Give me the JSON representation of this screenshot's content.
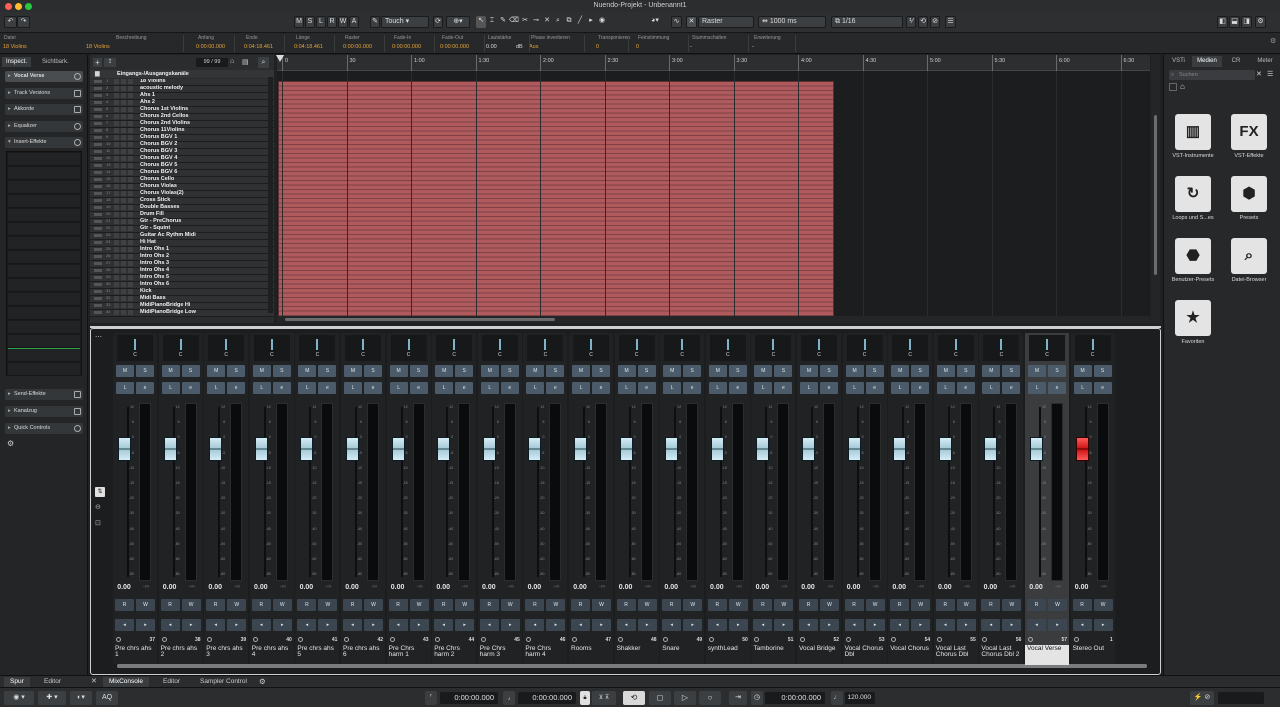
{
  "window": {
    "title": "Nuendo-Projekt - Unbenannt1"
  },
  "toolbar": {
    "mode_buttons": [
      "M",
      "S",
      "L",
      "R",
      "W",
      "A"
    ],
    "automation_mode": "Touch",
    "grid_label": "Raster",
    "nudge_value": "1000 ms",
    "quantize_value": "1/16"
  },
  "infoline": {
    "fields": [
      {
        "label": "Datei",
        "value": "18 Violins"
      },
      {
        "label": "Beschreibung",
        "value": "18 Violins"
      },
      {
        "label": "Anfang",
        "value": "0:00:00.000"
      },
      {
        "label": "Ende",
        "value": "0:04:18.461"
      },
      {
        "label": "Länge",
        "value": "0:04:18.461"
      },
      {
        "label": "Raster",
        "value": "0:00:00.000"
      },
      {
        "label": "Fade-In",
        "value": "0:00:00.000"
      },
      {
        "label": "Fade-Out",
        "value": "0:00:00.000"
      },
      {
        "label": "Lautstärke",
        "value": "0.00"
      },
      {
        "label": "Phase invertieren",
        "value": "Aus"
      },
      {
        "label": "Transponieren",
        "value": "0"
      },
      {
        "label": "Feinstimmung",
        "value": "0"
      },
      {
        "label": "Stummschalten",
        "value": "-"
      },
      {
        "label": "Erweiterung",
        "value": "-"
      }
    ],
    "volume_unit": "dB"
  },
  "inspector": {
    "tabs": [
      "Inspect.",
      "Sichtbark."
    ],
    "track_name": "Vocal Verse",
    "sections": [
      "Track Versions",
      "Akkorde",
      "Equalizer",
      "Insert-Effekte"
    ],
    "bottom_sections": [
      "Send-Effekte",
      "Kanalzug",
      "Quick Controls"
    ]
  },
  "tracklist": {
    "counter": "99 / 99",
    "header": "Eingangs-/Ausgangskanäle",
    "tracks": [
      "18 Violins",
      "acoustic melody",
      "Ahs 1",
      "Ahs 2",
      "Chorus 1st Violins",
      "Chorus 2nd Cellos",
      "Chorus 2nd Violins",
      "Chorus 11Violins",
      "Chorus BGV 1",
      "Chorus BGV 2",
      "Chorus BGV 3",
      "Chorus BGV 4",
      "Chorus BGV 5",
      "Chorus BGV 6",
      "Chorus Cello",
      "Chorus Violas",
      "Chorus Violas(2)",
      "Cross Stick",
      "Double Basses",
      "Drum Fill",
      "Gtr - PreChorus",
      "Gtr - Squint",
      "Guitar Ac Rythm Midi",
      "Hi Hat",
      "Intro Ohs 1",
      "Intro Ohs 2",
      "Intro Ohs 3",
      "Intro Ohs 4",
      "Intro Ohs 5",
      "Intro Ohs 6",
      "Kick",
      "Midi Bass",
      "MidiPianoBridge Hi",
      "MidiPianoBridge Low"
    ]
  },
  "ruler": {
    "ticks": [
      "0",
      "30",
      "1:00",
      "1:30",
      "2:00",
      "2:30",
      "3:00",
      "3:30",
      "4:00",
      "4:30",
      "5:00",
      "5:30",
      "6:00",
      "6:30"
    ]
  },
  "right_zone": {
    "tabs": [
      "VSTi",
      "Medien",
      "CR",
      "Meter"
    ],
    "active_tab": "Medien",
    "search_placeholder": "Suchen",
    "items": [
      {
        "label": "VST-Instrumente",
        "icon": "piano-keys-icon",
        "glyph": "▥"
      },
      {
        "label": "VST-Effekte",
        "icon": "fx-icon",
        "glyph": "FX"
      },
      {
        "label": "Loops und S...es",
        "icon": "loop-icon",
        "glyph": "↻"
      },
      {
        "label": "Presets",
        "icon": "presets-icon",
        "glyph": "⬢"
      },
      {
        "label": "Benutzer-Presets",
        "icon": "user-presets-icon",
        "glyph": "⬣"
      },
      {
        "label": "Datei-Browser",
        "icon": "file-browser-icon",
        "glyph": "⌕"
      },
      {
        "label": "Favoriten",
        "icon": "star-icon",
        "glyph": "★"
      }
    ]
  },
  "mixer": {
    "channels": [
      {
        "name": "Pre chrs ahs 1",
        "num": "37",
        "vol": "0.00",
        "pan": "C"
      },
      {
        "name": "Pre chrs ahs 2",
        "num": "38",
        "vol": "0.00",
        "pan": "C"
      },
      {
        "name": "Pre chrs ahs 3",
        "num": "39",
        "vol": "0.00",
        "pan": "C"
      },
      {
        "name": "Pre chrs ahs 4",
        "num": "40",
        "vol": "0.00",
        "pan": "C"
      },
      {
        "name": "Pre chrs ahs 5",
        "num": "41",
        "vol": "0.00",
        "pan": "C"
      },
      {
        "name": "Pre chrs ahs 6",
        "num": "42",
        "vol": "0.00",
        "pan": "C"
      },
      {
        "name": "Pre Chrs harm 1",
        "num": "43",
        "vol": "0.00",
        "pan": "C"
      },
      {
        "name": "Pre Chrs harm 2",
        "num": "44",
        "vol": "0.00",
        "pan": "C"
      },
      {
        "name": "Pre Chrs harm 3",
        "num": "45",
        "vol": "0.00",
        "pan": "C"
      },
      {
        "name": "Pre Chrs harm 4",
        "num": "46",
        "vol": "0.00",
        "pan": "C"
      },
      {
        "name": "Rooms",
        "num": "47",
        "vol": "0.00",
        "pan": "C"
      },
      {
        "name": "Shakker",
        "num": "48",
        "vol": "0.00",
        "pan": "C"
      },
      {
        "name": "Snare",
        "num": "49",
        "vol": "0.00",
        "pan": "C"
      },
      {
        "name": "synthLead",
        "num": "50",
        "vol": "0.00",
        "pan": "C"
      },
      {
        "name": "Tamborine",
        "num": "51",
        "vol": "0.00",
        "pan": "C"
      },
      {
        "name": "Vocal  Bridge",
        "num": "52",
        "vol": "0.00",
        "pan": "C"
      },
      {
        "name": "Vocal Chorus Dbl",
        "num": "53",
        "vol": "0.00",
        "pan": "C"
      },
      {
        "name": "Vocal Chorus",
        "num": "54",
        "vol": "0.00",
        "pan": "C"
      },
      {
        "name": "Vocal Last Chorus Dbl",
        "num": "55",
        "vol": "0.00",
        "pan": "C"
      },
      {
        "name": "Vocal Last Chorus Dbl 2",
        "num": "56",
        "vol": "0.00",
        "pan": "C"
      },
      {
        "name": "Vocal Verse",
        "num": "57",
        "vol": "0.00",
        "pan": "C"
      },
      {
        "name": "Stereo Out",
        "num": "1",
        "vol": "0.00",
        "pan": "C"
      }
    ],
    "peak": "-∞",
    "scale": [
      "12",
      "6",
      "0",
      "-5",
      "-10",
      "-15",
      "-20",
      "-30",
      "-40",
      "-50",
      "-60",
      "-80"
    ]
  },
  "bottom_tabs": [
    "Spur",
    "Editor",
    "MixConsole",
    "Editor",
    "Sampler Control"
  ],
  "transport": {
    "left_locator": "0:00:00.000",
    "right_locator": "0:00:00.000",
    "position": "0:00:00.000",
    "tempo": "120.000",
    "aq": "AQ"
  }
}
